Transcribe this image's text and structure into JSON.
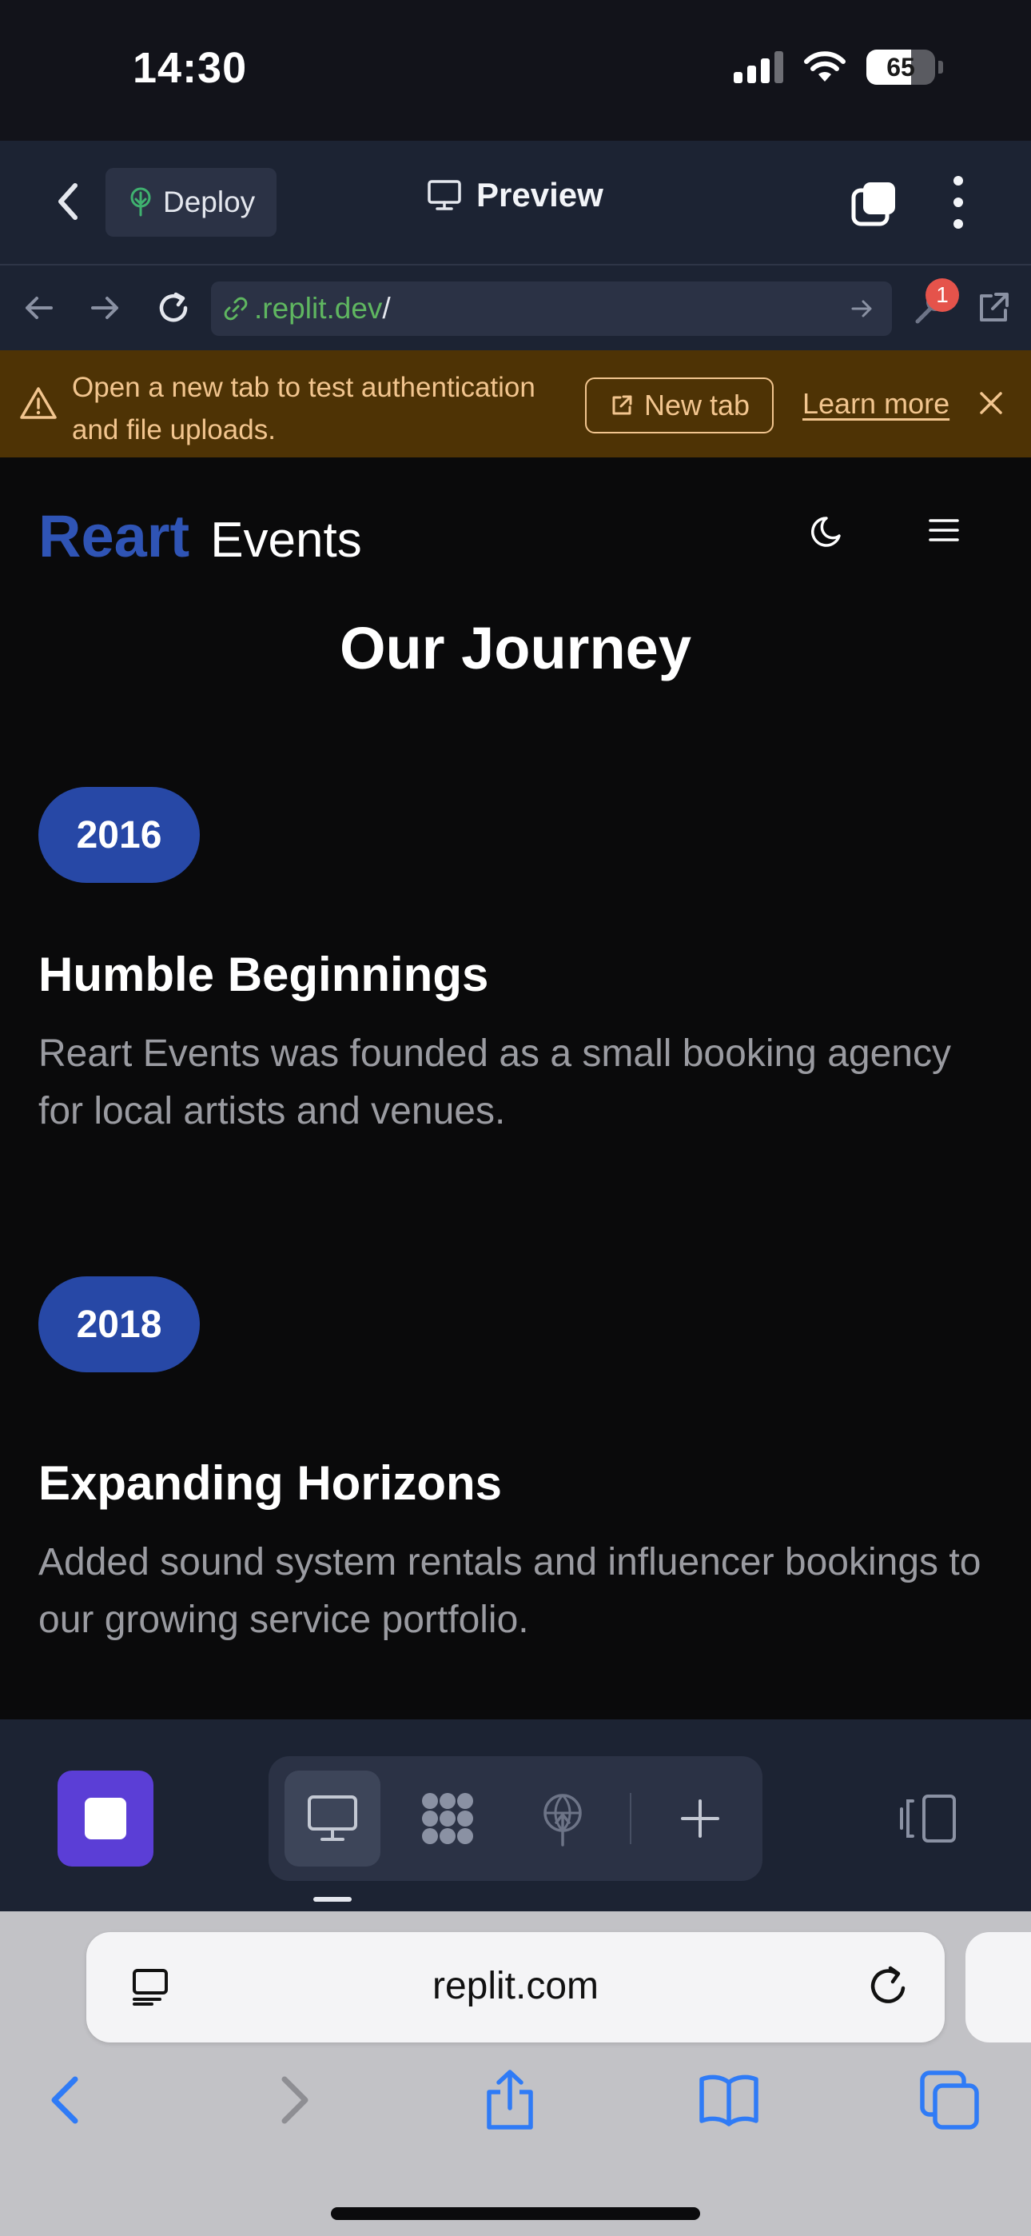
{
  "status_bar": {
    "time": "14:30",
    "battery": "65",
    "battery_level": 0.65
  },
  "header": {
    "deploy_label": "Deploy",
    "title": "Preview"
  },
  "url_bar": {
    "url_host": ".replit.dev",
    "url_path": "/",
    "notification_count": "1"
  },
  "banner": {
    "message": "Open a new tab to test authentication and file uploads.",
    "new_tab_label": "New tab",
    "learn_more_label": "Learn more"
  },
  "site": {
    "brand_main": "Reart",
    "brand_sub": "Events",
    "section_title": "Our Journey",
    "milestones": [
      {
        "year": "2016",
        "title": "Humble Beginnings",
        "description": "Reart Events was founded as a small booking agency for local artists and venues."
      },
      {
        "year": "2018",
        "title": "Expanding Horizons",
        "description": "Added sound system rentals and influencer bookings to our growing service portfolio."
      }
    ]
  },
  "safari": {
    "address": "replit.com"
  },
  "colors": {
    "brand_blue": "#2f54b5",
    "pill_blue": "#2748a6",
    "replit_bg": "#1c2333",
    "warning_text": "#f2c58f",
    "stop_purple": "#5b3ed6",
    "link_blue": "#2f7bf6"
  }
}
